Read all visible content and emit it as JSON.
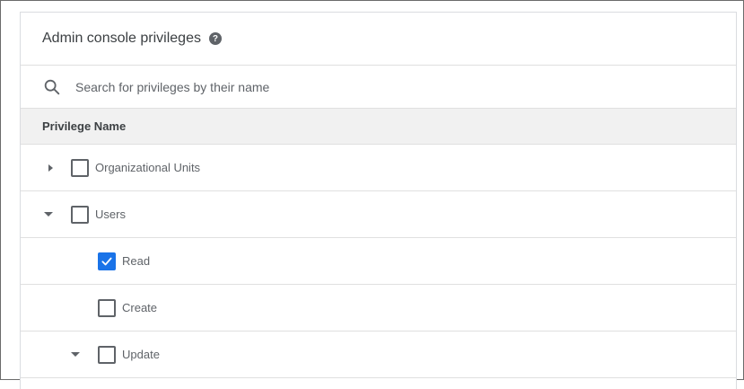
{
  "header": {
    "title": "Admin console privileges",
    "help_icon": "help-circle-icon"
  },
  "search": {
    "icon": "search-icon",
    "placeholder": "Search for privileges by their name"
  },
  "table": {
    "column_header": "Privilege Name",
    "rows": [
      {
        "label": "Organizational Units",
        "expanded": false,
        "checked": false,
        "level": 0
      },
      {
        "label": "Users",
        "expanded": true,
        "checked": false,
        "level": 0
      },
      {
        "label": "Read",
        "checked": true,
        "level": 1
      },
      {
        "label": "Create",
        "checked": false,
        "level": 1
      },
      {
        "label": "Update",
        "expanded": true,
        "checked": false,
        "level": 1
      }
    ]
  },
  "colors": {
    "checked": "#1a73e8",
    "header_bg": "#f1f1f1",
    "divider": "#e0e0e0",
    "text": "#3c4043",
    "muted_text": "#5f6368"
  }
}
